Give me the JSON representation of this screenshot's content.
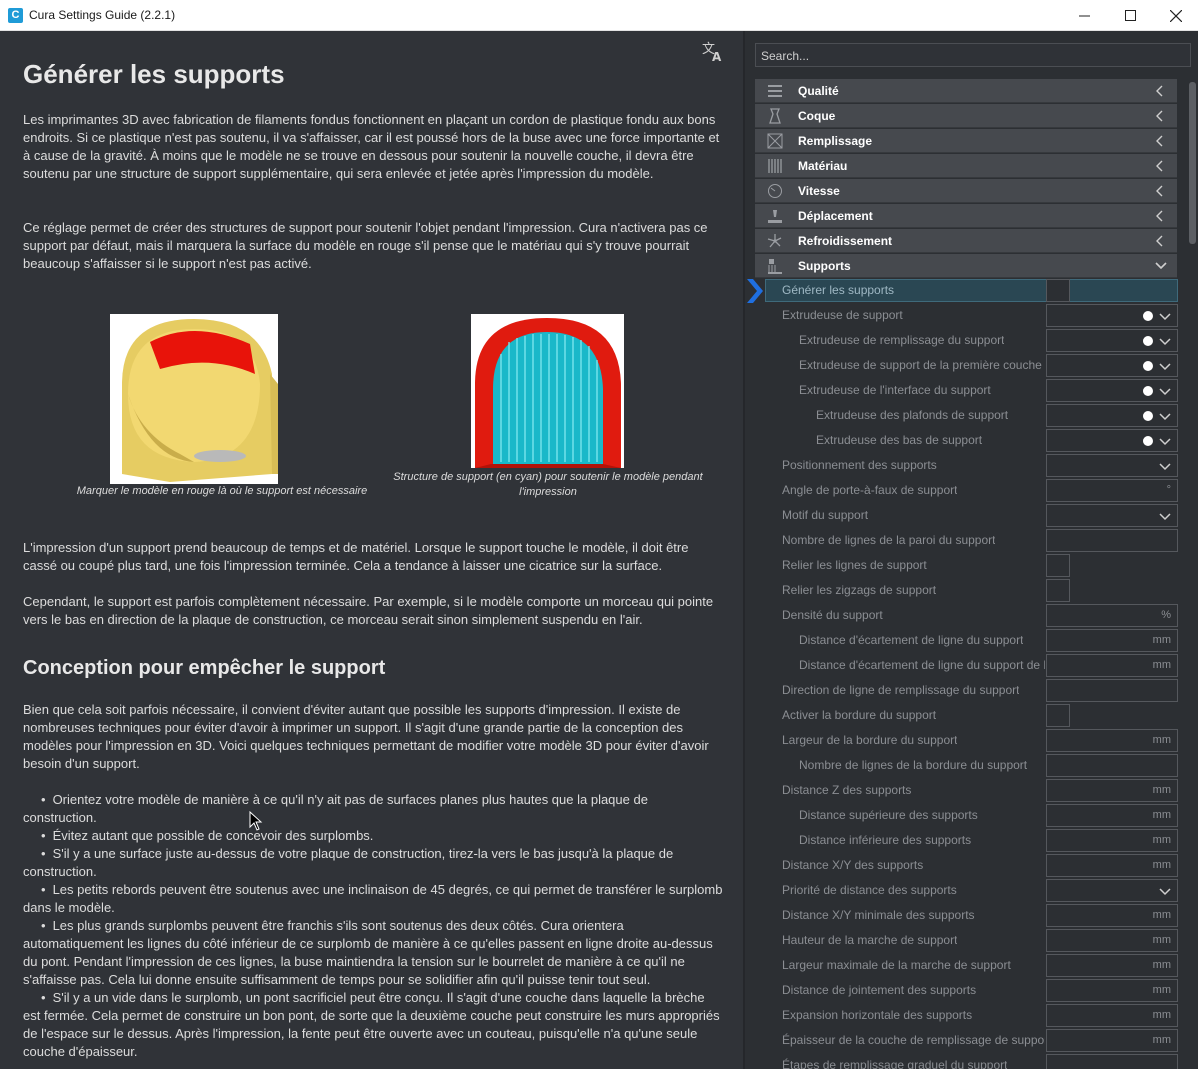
{
  "window": {
    "title": "Cura Settings Guide (2.2.1)",
    "app_icon": "cura-app-icon",
    "controls": [
      "minimize-icon",
      "maximize-icon",
      "close-icon"
    ]
  },
  "article": {
    "title": "Générer les supports",
    "paragraphs": [
      "Les imprimantes 3D avec fabrication de filaments fondus fonctionnent en plaçant un cordon de plastique fondu aux bons endroits. Si ce plastique n'est pas soutenu, il va s'affaisser, car il est poussé hors de la buse avec une force importante et à cause de la gravité. À moins que le modèle ne se trouve en dessous pour soutenir la nouvelle couche, il devra être soutenu par une structure de support supplémentaire, qui sera enlevée et jetée après l'impression du modèle.",
      "Ce réglage permet de créer des structures de support pour soutenir l'objet pendant l'impression. Cura n'activera pas ce support par défaut, mais il marquera la surface du modèle en rouge s'il pense que le matériau qui s'y trouve pourrait beaucoup s'affaisser si le support n'est pas activé.",
      "L'impression d'un support prend beaucoup de temps et de matériel. Lorsque le support touche le modèle, il doit être cassé ou coupé plus tard, une fois l'impression terminée. Cela a tendance à laisser une cicatrice sur la surface.",
      "Cependant, le support est parfois complètement nécessaire. Par exemple, si le modèle comporte un morceau qui pointe vers le bas en direction de la plaque de construction, ce morceau serait sinon simplement suspendu en l'air."
    ],
    "figures": [
      {
        "caption": "Marquer le modèle en rouge là où le support est nécessaire"
      },
      {
        "caption": "Structure de support (en cyan) pour soutenir le modèle pendant l'impression"
      }
    ],
    "section2": {
      "title": "Conception pour empêcher le support",
      "intro": "Bien que cela soit parfois nécessaire, il convient d'éviter autant que possible les supports d'impression. Il existe de nombreuses techniques pour éviter d'avoir à imprimer un support. Il s'agit d'une grande partie de la conception des modèles pour l'impression en 3D. Voici quelques techniques permettant de modifier votre modèle 3D pour éviter d'avoir besoin d'un support.",
      "bullets": [
        "Orientez votre modèle de manière à ce qu'il n'y ait pas de surfaces planes plus hautes que la plaque de construction.",
        "Évitez autant que possible de concevoir des surplombs.",
        "S'il y a une surface juste au-dessus de votre plaque de construction, tirez-la vers le bas jusqu'à la plaque de construction.",
        "Les petits rebords peuvent être soutenus avec une inclinaison de 45 degrés, ce qui permet de transférer le surplomb dans le modèle.",
        "Les plus grands surplombs peuvent être franchis s'ils sont soutenus des deux côtés. Cura orientera automatiquement les lignes du côté inférieur de ce surplomb de manière à ce qu'elles passent en ligne droite au-dessus du pont. Pendant l'impression de ces lignes, la buse maintiendra la tension sur le bourrelet de manière à ce qu'il ne s'affaisse pas. Cela lui donne ensuite suffisamment de temps pour se solidifier afin qu'il puisse tenir tout seul.",
        "S'il y a un vide dans le surplomb, un pont sacrificiel peut être conçu. Il s'agit d'une couche dans laquelle la brèche est fermée. Cela permet de construire un bon pont, de sorte que la deuxième couche peut construire les murs appropriés de l'espace sur le dessus. Après l'impression, la fente peut être ouverte avec un couteau, puisqu'elle n'a qu'une seule couche d'épaisseur."
      ]
    }
  },
  "sidebar": {
    "search_placeholder": "Search...",
    "categories": [
      {
        "label": "Qualité",
        "icon": "quality-icon",
        "expanded": false
      },
      {
        "label": "Coque",
        "icon": "shell-icon",
        "expanded": false
      },
      {
        "label": "Remplissage",
        "icon": "infill-icon",
        "expanded": false
      },
      {
        "label": "Matériau",
        "icon": "material-icon",
        "expanded": false
      },
      {
        "label": "Vitesse",
        "icon": "speed-icon",
        "expanded": false
      },
      {
        "label": "Déplacement",
        "icon": "travel-icon",
        "expanded": false
      },
      {
        "label": "Refroidissement",
        "icon": "cooling-icon",
        "expanded": false
      },
      {
        "label": "Supports",
        "icon": "support-icon",
        "expanded": true
      }
    ],
    "settings": [
      {
        "label": "Générer les supports",
        "level": 0,
        "type": "check",
        "active": true
      },
      {
        "label": "Extrudeuse de support",
        "level": 0,
        "type": "extruder"
      },
      {
        "label": "Extrudeuse de remplissage du support",
        "level": 1,
        "type": "extruder"
      },
      {
        "label": "Extrudeuse de support de la première couche",
        "level": 1,
        "type": "extruder"
      },
      {
        "label": "Extrudeuse de l'interface du support",
        "level": 1,
        "type": "extruder"
      },
      {
        "label": "Extrudeuse des plafonds de support",
        "level": 2,
        "type": "extruder"
      },
      {
        "label": "Extrudeuse des bas de support",
        "level": 2,
        "type": "extruder"
      },
      {
        "label": "Positionnement des supports",
        "level": 0,
        "type": "dropdown"
      },
      {
        "label": "Angle de porte-à-faux de support",
        "level": 0,
        "type": "unit",
        "unit": "°"
      },
      {
        "label": "Motif du support",
        "level": 0,
        "type": "dropdown"
      },
      {
        "label": "Nombre de lignes de la paroi du support",
        "level": 0,
        "type": "field"
      },
      {
        "label": "Relier les lignes de support",
        "level": 0,
        "type": "check"
      },
      {
        "label": "Relier les zigzags de support",
        "level": 0,
        "type": "check"
      },
      {
        "label": "Densité du support",
        "level": 0,
        "type": "unit",
        "unit": "%"
      },
      {
        "label": "Distance d'écartement de ligne du support",
        "level": 1,
        "type": "unit",
        "unit": "mm"
      },
      {
        "label": "Distance d'écartement de ligne du support de la",
        "level": 1,
        "type": "unit",
        "unit": "mm"
      },
      {
        "label": "Direction de ligne de remplissage du support",
        "level": 0,
        "type": "field"
      },
      {
        "label": "Activer la bordure du support",
        "level": 0,
        "type": "check"
      },
      {
        "label": "Largeur de la bordure du support",
        "level": 0,
        "type": "unit",
        "unit": "mm"
      },
      {
        "label": "Nombre de lignes de la bordure du support",
        "level": 1,
        "type": "field"
      },
      {
        "label": "Distance Z des supports",
        "level": 0,
        "type": "unit",
        "unit": "mm"
      },
      {
        "label": "Distance supérieure des supports",
        "level": 1,
        "type": "unit",
        "unit": "mm"
      },
      {
        "label": "Distance inférieure des supports",
        "level": 1,
        "type": "unit",
        "unit": "mm"
      },
      {
        "label": "Distance X/Y des supports",
        "level": 0,
        "type": "unit",
        "unit": "mm"
      },
      {
        "label": "Priorité de distance des supports",
        "level": 0,
        "type": "dropdown"
      },
      {
        "label": "Distance X/Y minimale des supports",
        "level": 0,
        "type": "unit",
        "unit": "mm"
      },
      {
        "label": "Hauteur de la marche de support",
        "level": 0,
        "type": "unit",
        "unit": "mm"
      },
      {
        "label": "Largeur maximale de la marche de support",
        "level": 0,
        "type": "unit",
        "unit": "mm"
      },
      {
        "label": "Distance de jointement des supports",
        "level": 0,
        "type": "unit",
        "unit": "mm"
      },
      {
        "label": "Expansion horizontale des supports",
        "level": 0,
        "type": "unit",
        "unit": "mm"
      },
      {
        "label": "Épaisseur de la couche de remplissage de support",
        "level": 0,
        "type": "unit",
        "unit": "mm"
      },
      {
        "label": "Étapes de remplissage graduel du support",
        "level": 0,
        "type": "field"
      }
    ]
  },
  "colors": {
    "background": "#303338",
    "sidebar": "#2c2f33",
    "category": "#46494e",
    "active_row": "#2a4753",
    "accent": "#1f6fe0"
  }
}
